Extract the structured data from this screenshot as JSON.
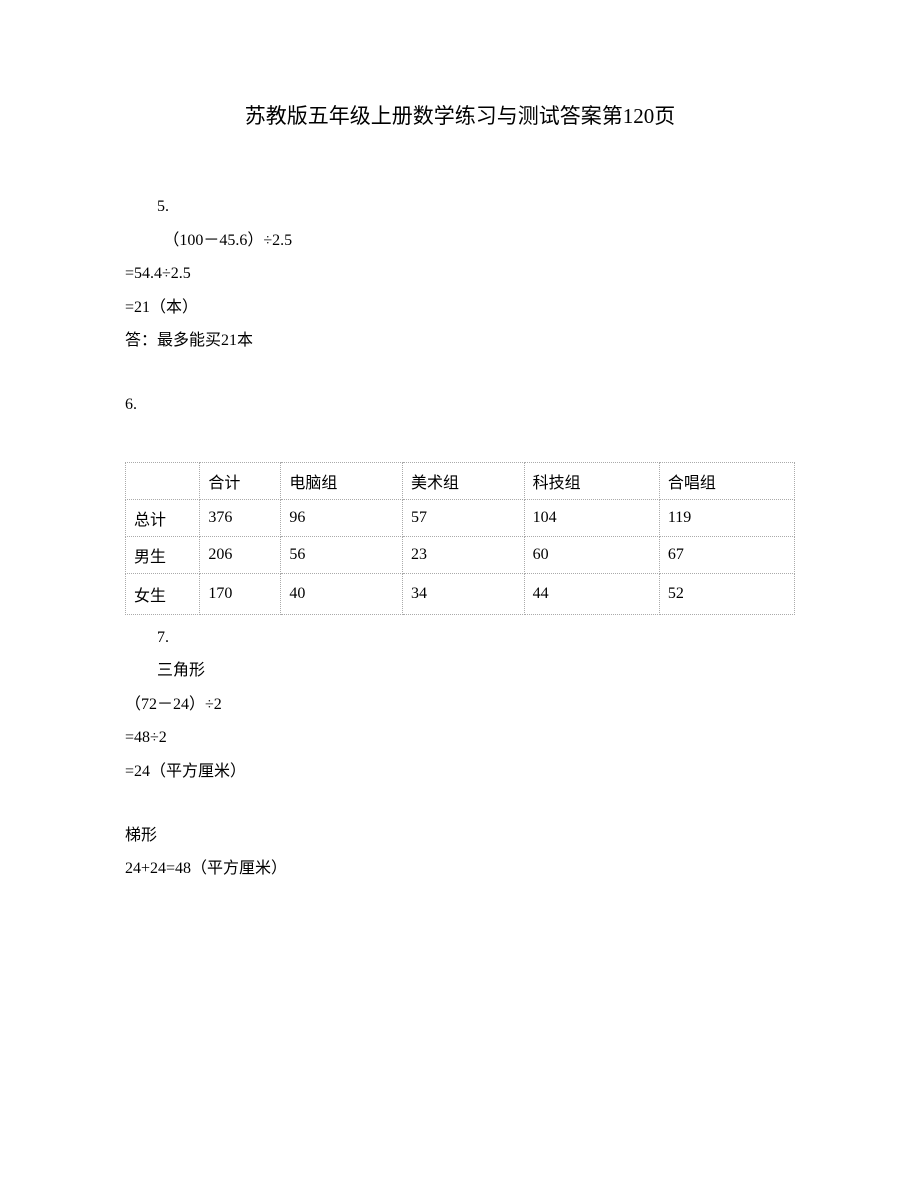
{
  "title": "苏教版五年级上册数学练习与测试答案第120页",
  "q5": {
    "num": "5.",
    "step1": "（100－45.6）÷2.5",
    "step2": "=54.4÷2.5",
    "step3": "=21（本）",
    "answer": "答：最多能买21本"
  },
  "q6": {
    "num": "6.",
    "headers": [
      "",
      "合计",
      "电脑组",
      "美术组",
      "科技组",
      "合唱组"
    ],
    "rows": [
      [
        "总计",
        "376",
        "96",
        "57",
        "104",
        "119"
      ],
      [
        "男生",
        "206",
        "56",
        "23",
        "60",
        "67"
      ],
      [
        "女生",
        "170",
        "40",
        "34",
        "44",
        "52"
      ]
    ]
  },
  "q7": {
    "num": "7.",
    "shape1": "三角形",
    "step1": "（72－24）÷2",
    "step2": "=48÷2",
    "step3": "=24（平方厘米）",
    "shape2": "梯形",
    "step4": "24+24=48（平方厘米）"
  },
  "chart_data": {
    "type": "table",
    "title": "第6题数据表",
    "columns": [
      "",
      "合计",
      "电脑组",
      "美术组",
      "科技组",
      "合唱组"
    ],
    "rows": [
      {
        "label": "总计",
        "values": [
          376,
          96,
          57,
          104,
          119
        ]
      },
      {
        "label": "男生",
        "values": [
          206,
          56,
          23,
          60,
          67
        ]
      },
      {
        "label": "女生",
        "values": [
          170,
          40,
          34,
          44,
          52
        ]
      }
    ]
  }
}
